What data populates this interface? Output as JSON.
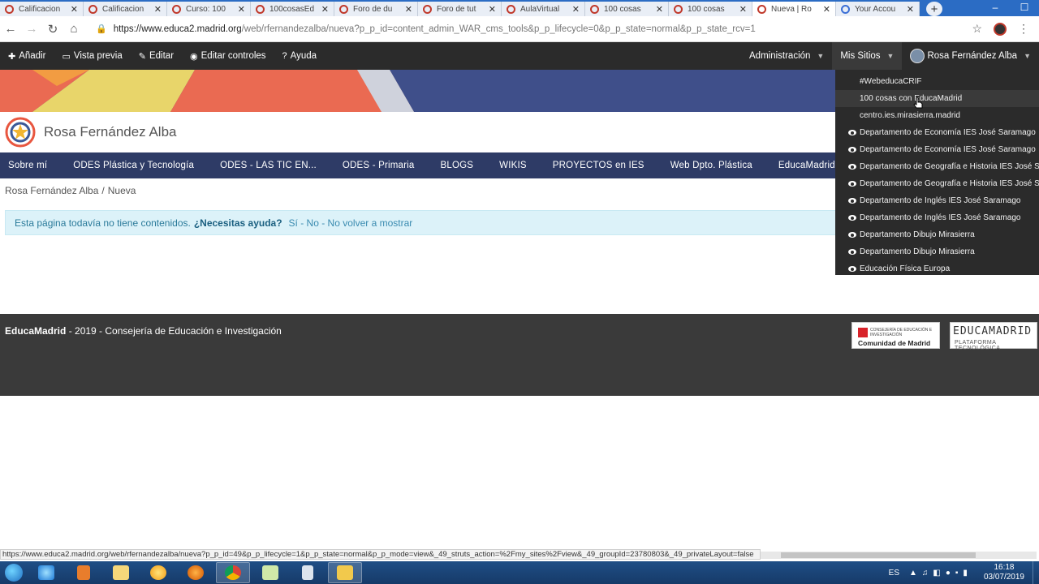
{
  "browser": {
    "tabs": [
      {
        "label": "Calificacion",
        "icon": "educamadrid-favicon"
      },
      {
        "label": "Calificacion",
        "icon": "educamadrid-favicon"
      },
      {
        "label": "Curso: 100",
        "icon": "educamadrid-favicon"
      },
      {
        "label": "100cosasEd",
        "icon": "educamadrid-favicon"
      },
      {
        "label": "Foro de du",
        "icon": "educamadrid-favicon"
      },
      {
        "label": "Foro de tut",
        "icon": "educamadrid-favicon"
      },
      {
        "label": "AulaVirtual",
        "icon": "educamadrid-favicon"
      },
      {
        "label": "100 cosas",
        "icon": "educamadrid-favicon"
      },
      {
        "label": "100 cosas",
        "icon": "educamadrid-favicon"
      },
      {
        "label": "Nueva | Ro",
        "icon": "educamadrid-favicon",
        "active": true
      },
      {
        "label": "Your Accou",
        "icon": "google-favicon"
      }
    ],
    "url_host": "https://www.educa2.madrid.org",
    "url_path": "/web/rfernandezalba/nueva?p_p_id=content_admin_WAR_cms_tools&p_p_lifecycle=0&p_p_state=normal&p_p_state_rcv=1"
  },
  "dockbar": {
    "left": [
      {
        "icon": "plus-icon",
        "label": "Añadir"
      },
      {
        "icon": "monitor-icon",
        "label": "Vista previa"
      },
      {
        "icon": "pencil-icon",
        "label": "Editar"
      },
      {
        "icon": "eye-icon",
        "label": "Editar controles"
      },
      {
        "icon": "question-icon",
        "label": "Ayuda"
      }
    ],
    "admin": "Administración",
    "my_sites": "Mis Sitios",
    "user": "Rosa Fernández Alba"
  },
  "site": {
    "name": "Rosa Fernández Alba",
    "nav": [
      "Sobre mí",
      "ODES Plástica y Tecnología",
      "ODES - LAS TIC EN...",
      "ODES - Primaria",
      "BLOGS",
      "WIKIS",
      "PROYECTOS en IES",
      "Web Dpto. Plástica",
      "EducaMadrid"
    ],
    "breadcrumb": [
      "Rosa Fernández Alba",
      "Nueva"
    ],
    "alert": {
      "text": "Esta página todavía no tiene contenidos.",
      "help": "¿Necesitas ayuda?",
      "options": "Sí - No - No volver a mostrar"
    }
  },
  "my_sites_menu": [
    {
      "label": "#WebeducaCRIF",
      "eye": false
    },
    {
      "label": "100 cosas con EducaMadrid",
      "eye": false,
      "hover": true
    },
    {
      "label": "centro.ies.mirasierra.madrid",
      "eye": false
    },
    {
      "label": "Departamento de Economía IES José Saramago",
      "eye": true
    },
    {
      "label": "Departamento de Economía IES José Saramago",
      "eye": true
    },
    {
      "label": "Departamento de Geografía e Historia IES José Saramago",
      "eye": true
    },
    {
      "label": "Departamento de Geografía e Historia IES José Saramago",
      "eye": true
    },
    {
      "label": "Departamento de Inglés IES José Saramago",
      "eye": true
    },
    {
      "label": "Departamento de Inglés IES José Saramago",
      "eye": true
    },
    {
      "label": "Departamento Dibujo Mirasierra",
      "eye": true
    },
    {
      "label": "Departamento Dibujo Mirasierra",
      "eye": true
    },
    {
      "label": "Educación Física Europa",
      "eye": true
    }
  ],
  "footer": {
    "brand": "EducaMadrid",
    "text": " - 2019 - Consejería de Educación e Investigación",
    "logo_cm_small": "CONSEJERÍA DE EDUCACIÓN E INVESTIGACIÓN",
    "logo_cm_big": "Comunidad de Madrid",
    "logo_em_title": "EDUCAMADRID",
    "logo_em_sub": "PLATAFORMA TECNOLÓGICA"
  },
  "status_url": "https://www.educa2.madrid.org/web/rfernandezalba/nueva?p_p_id=49&p_p_lifecycle=1&p_p_state=normal&p_p_mode=view&_49_struts_action=%2Fmy_sites%2Fview&_49_groupId=23780803&_49_privateLayout=false",
  "taskbar": {
    "lang": "ES",
    "time": "16:18",
    "date": "03/07/2019"
  },
  "colors": {
    "dockbar": "#2b2b2b",
    "mainnav": "#2e3b66",
    "alert_bg": "#dcf2f9",
    "footer": "#3a3a3a"
  }
}
